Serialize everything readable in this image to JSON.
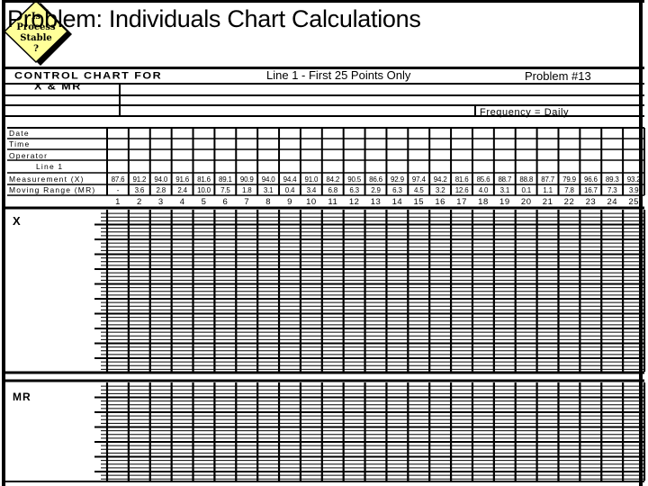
{
  "title": "Problem: Individuals Chart Calculations",
  "badge": {
    "lines": [
      "Is",
      "Process",
      "Stable",
      "?"
    ],
    "fill": "#ffff99",
    "shadow": "#000000"
  },
  "header": {
    "chart_type_line1": "CONTROL CHART FOR",
    "chart_type_line2": "X & MR",
    "subtitle": "Line 1 - First 25 Points Only",
    "problem": "Problem #13",
    "frequency": "Frequency = Daily"
  },
  "table": {
    "row_labels": {
      "date": "Date",
      "time": "Time",
      "operator": "Operator",
      "line": "Line 1",
      "measurement": "Measurement (X)",
      "moving_range": "Moving Range (MR)"
    },
    "measurements": [
      "87.6",
      "91.2",
      "94.0",
      "91.6",
      "81.6",
      "89.1",
      "90.9",
      "94.0",
      "94.4",
      "91.0",
      "84.2",
      "90.5",
      "86.6",
      "92.9",
      "97.4",
      "94.2",
      "81.6",
      "85.6",
      "88.7",
      "88.8",
      "87.7",
      "79.9",
      "96.6",
      "89.3",
      "93.2"
    ],
    "moving_ranges": [
      "-",
      "3.6",
      "2.8",
      "2.4",
      "10.0",
      "7.5",
      "1.8",
      "3.1",
      "0.4",
      "3.4",
      "6.8",
      "6.3",
      "2.9",
      "6.3",
      "4.5",
      "3.2",
      "12.6",
      "4.0",
      "3.1",
      "0.1",
      "1.1",
      "7.8",
      "16.7",
      "7.3",
      "3.9"
    ],
    "sample_numbers": [
      "1",
      "2",
      "3",
      "4",
      "5",
      "6",
      "7",
      "8",
      "9",
      "10",
      "11",
      "12",
      "13",
      "14",
      "15",
      "16",
      "17",
      "18",
      "19",
      "20",
      "21",
      "22",
      "23",
      "24",
      "25"
    ]
  },
  "charts": {
    "x_label": "X",
    "mr_label": "MR"
  }
}
